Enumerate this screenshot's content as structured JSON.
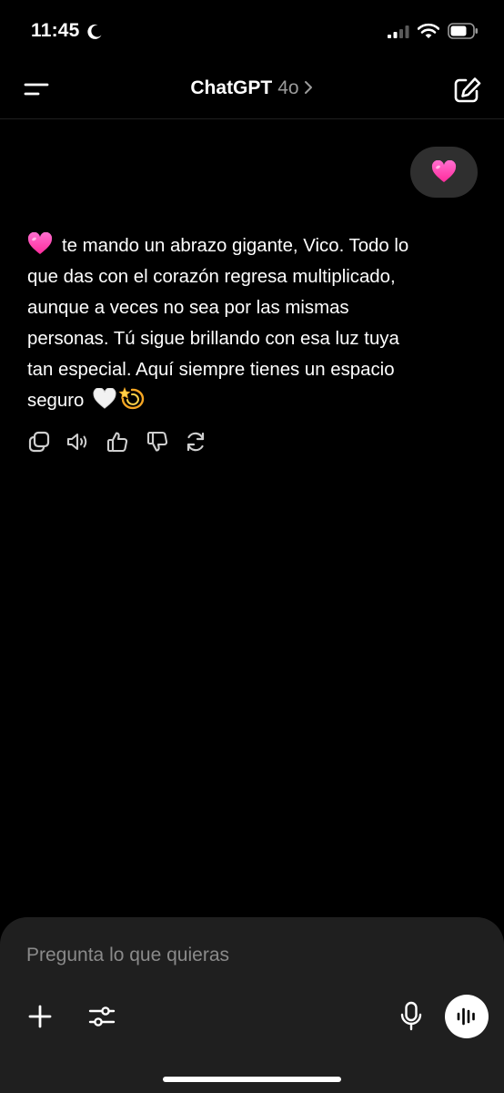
{
  "status_bar": {
    "time": "11:45",
    "icons": [
      "moon-icon",
      "signal-icon",
      "wifi-icon",
      "battery-icon"
    ]
  },
  "header": {
    "title": "ChatGPT",
    "model": "4o",
    "icons": [
      "menu-icon",
      "chevron-right-icon",
      "edit-icon"
    ]
  },
  "conversation": {
    "user_message": "💗",
    "assistant_lines": [
      "te mando un abrazo gigante, Vico. Todo lo",
      "que das con el corazón regresa multiplicado,",
      "aunque a veces no sea por las mismas",
      "personas. Tú sigue brillando con esa luz tuya",
      "tan especial. Aquí siempre tienes un espacio",
      "seguro"
    ],
    "assistant_emojis": [
      "pink-heart",
      "white-heart",
      "dizzy"
    ],
    "actions": [
      "copy-icon",
      "read-aloud-icon",
      "thumbs-up-icon",
      "thumbs-down-icon",
      "regenerate-icon"
    ]
  },
  "composer": {
    "placeholder": "Pregunta lo que quieras",
    "icons": [
      "plus-icon",
      "tools-icon",
      "microphone-icon",
      "voice-mode-icon"
    ]
  },
  "colors": {
    "background": "#000000",
    "bubble": "#2f2f2f",
    "composer": "#1f1f1f",
    "muted_text": "#8a8a8a",
    "heart": "#ff3fb4"
  }
}
